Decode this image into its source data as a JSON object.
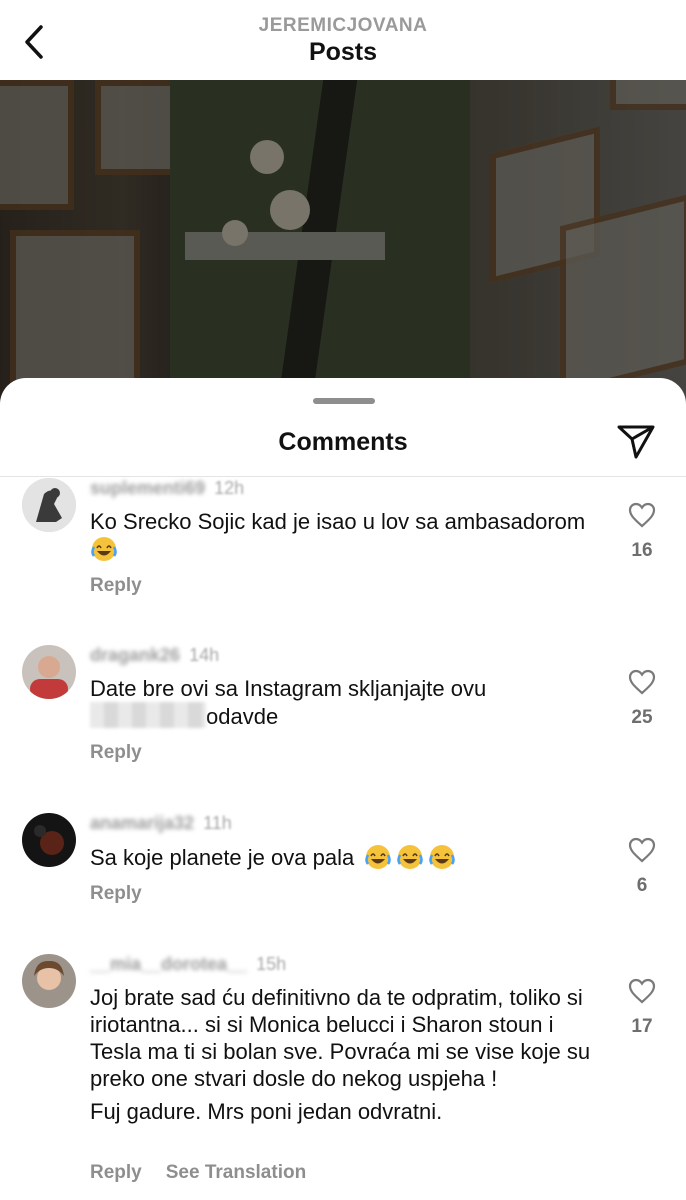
{
  "header": {
    "username": "JEREMICJOVANA",
    "title": "Posts"
  },
  "sheet": {
    "title": "Comments"
  },
  "comments": [
    {
      "username": "suplementi69",
      "time": "12h",
      "lines": [
        "Ko Srecko Sojic kad je isao u lov sa ambasadorom"
      ],
      "emoji_count": 1,
      "reply_label": "Reply",
      "likes": "16"
    },
    {
      "username": "dragank26",
      "time": "14h",
      "line1": "Date bre ovi sa Instagram skljanjajte ovu",
      "line2_after_redaction": "odavde",
      "reply_label": "Reply",
      "likes": "25"
    },
    {
      "username": "anamarija32",
      "time": "11h",
      "text": "Sa koje planete je ova pala",
      "emoji_count": 3,
      "reply_label": "Reply",
      "likes": "6"
    },
    {
      "username": "__mia__dorotea__",
      "time": "15h",
      "paragraph1": "Joj brate sad ću definitivno da te odpratim, toliko si iriotantna... si si Monica belucci i Sharon stoun i Tesla ma ti si bolan sve. Povraća mi se vise koje su preko one stvari dosle do nekog uspjeha !",
      "paragraph2": "Fuj gadure. Mrs poni jedan odvratni.",
      "reply_label": "Reply",
      "see_translation_label": "See Translation",
      "likes": "17"
    }
  ],
  "icons": {
    "back": "chevron-left-icon",
    "share": "paper-plane-icon",
    "like": "heart-outline-icon",
    "emoji": "face-with-tears-of-joy"
  }
}
